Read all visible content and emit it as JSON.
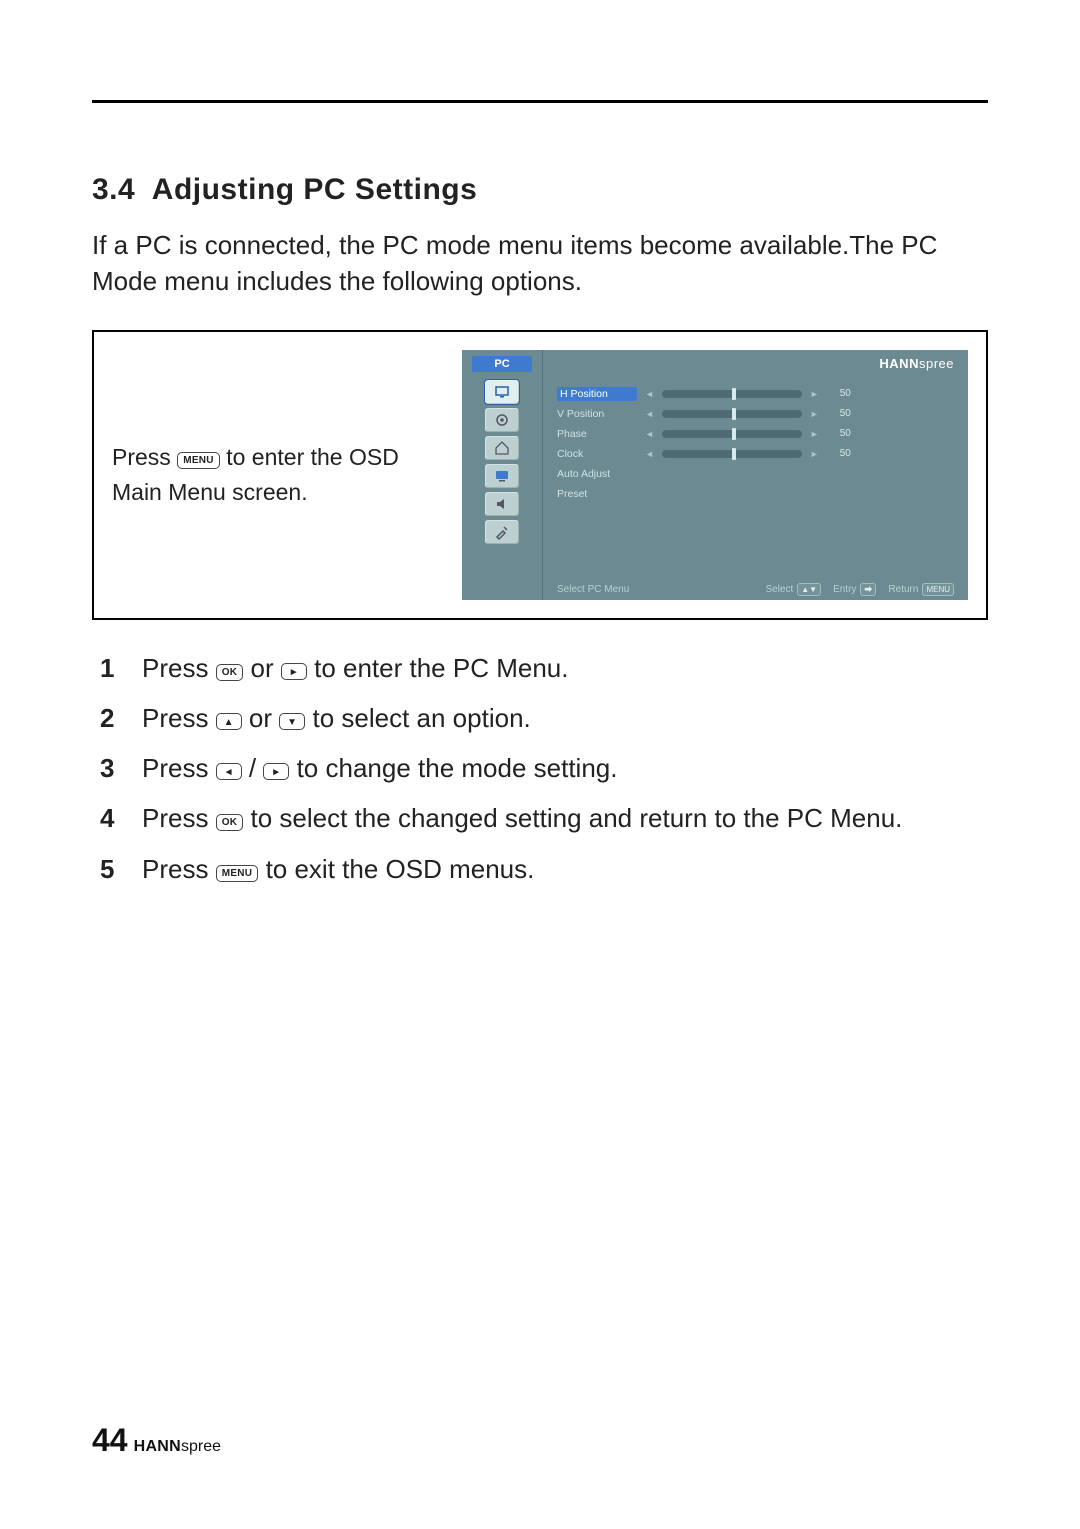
{
  "section": {
    "number": "3.4",
    "title": "Adjusting PC Settings",
    "intro": "If a PC is connected, the PC mode menu items become available.The PC Mode menu includes the following options."
  },
  "figure_instruction": {
    "press": "Press",
    "menu_key": "MENU",
    "rest": " to enter the OSD Main Menu screen."
  },
  "osd": {
    "tab_title": "PC",
    "brand_bold": "HANN",
    "brand_light": "spree",
    "sidebar_icons": [
      "pc-icon",
      "target-icon",
      "house-icon",
      "monitor-icon",
      "speaker-icon",
      "tools-icon"
    ],
    "rows": [
      {
        "label": "H Position",
        "value": 50,
        "slider": true,
        "highlight": true
      },
      {
        "label": "V Position",
        "value": 50,
        "slider": true
      },
      {
        "label": "Phase",
        "value": 50,
        "slider": true
      },
      {
        "label": "Clock",
        "value": 50,
        "slider": true
      },
      {
        "label": "Auto Adjust",
        "value": null,
        "slider": false
      },
      {
        "label": "Preset",
        "value": null,
        "slider": false
      }
    ],
    "footer": {
      "left": "Select PC Menu",
      "select_label": "Select",
      "entry_label": "Entry",
      "return_label": "Return",
      "return_key": "MENU"
    }
  },
  "keys": {
    "menu": "MENU",
    "ok": "OK"
  },
  "steps": [
    {
      "n": "1",
      "parts": [
        "Press ",
        {
          "key": "OK"
        },
        " or ",
        {
          "arrow": "right"
        },
        " to enter the PC Menu."
      ]
    },
    {
      "n": "2",
      "parts": [
        "Press ",
        {
          "arrow": "up"
        },
        " or ",
        {
          "arrow": "down"
        },
        " to select an option."
      ]
    },
    {
      "n": "3",
      "parts": [
        "Press ",
        {
          "arrow": "left"
        },
        " / ",
        {
          "arrow": "right"
        },
        " to change the mode setting."
      ]
    },
    {
      "n": "4",
      "parts": [
        "Press ",
        {
          "key": "OK"
        },
        " to select the changed setting and return to the PC Menu."
      ]
    },
    {
      "n": "5",
      "parts": [
        "Press ",
        {
          "key": "MENU"
        },
        " to exit the OSD menus."
      ]
    }
  ],
  "footer": {
    "page": "44",
    "brand_bold": "HANN",
    "brand_light": "spree"
  }
}
